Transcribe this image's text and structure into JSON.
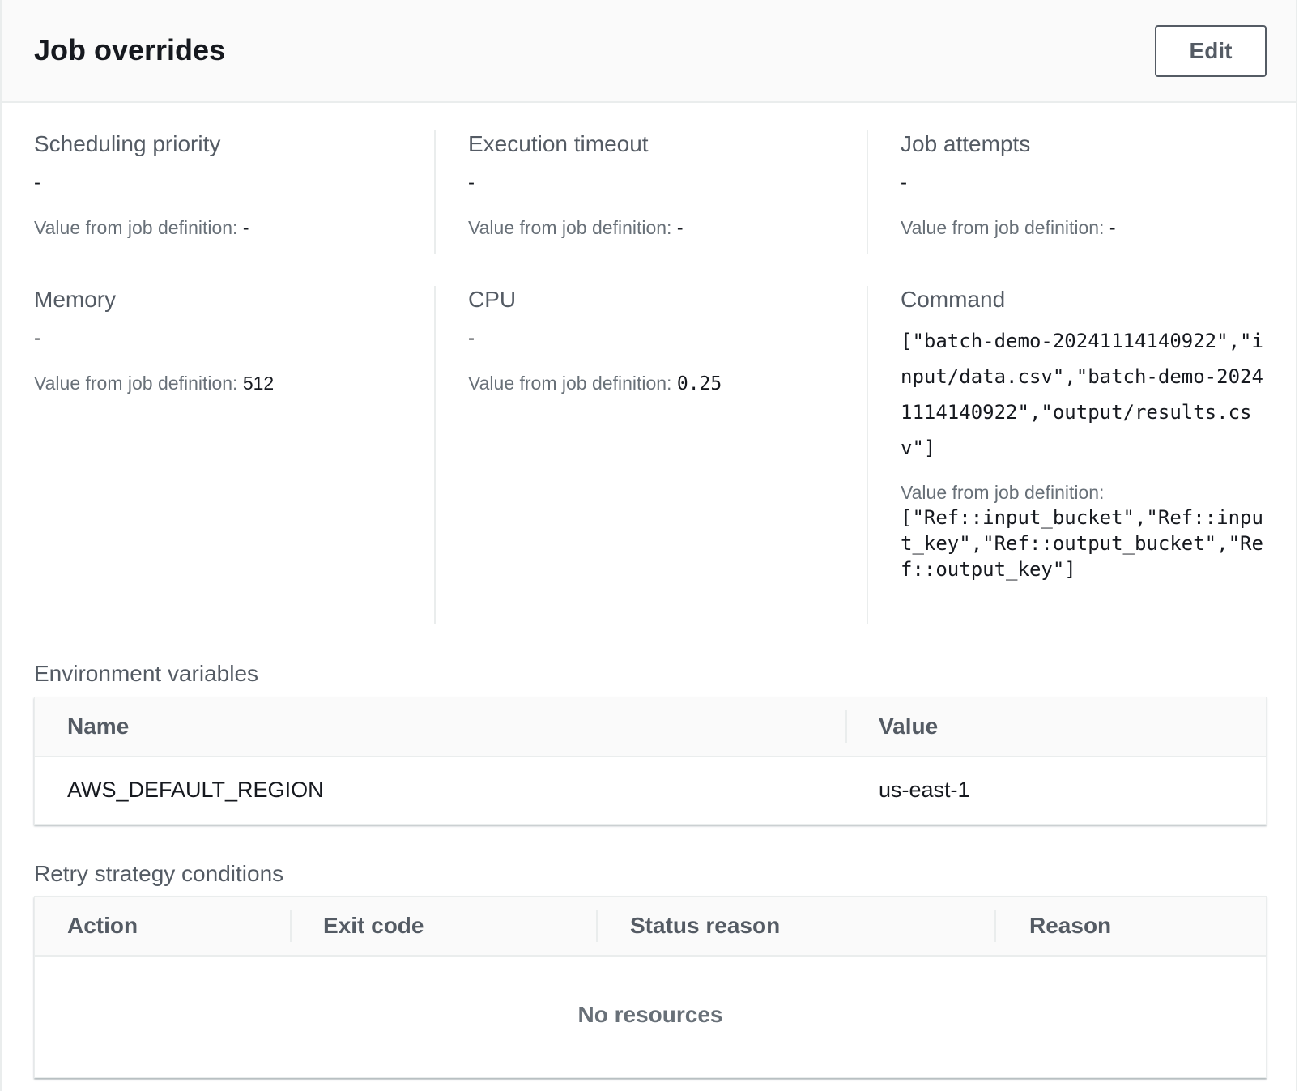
{
  "header": {
    "title": "Job overrides",
    "edit_label": "Edit"
  },
  "fields": {
    "scheduling_priority": {
      "label": "Scheduling priority",
      "value": "-",
      "def_prefix": "Value from job definition:",
      "def_value": "-"
    },
    "execution_timeout": {
      "label": "Execution timeout",
      "value": "-",
      "def_prefix": "Value from job definition:",
      "def_value": "-"
    },
    "job_attempts": {
      "label": "Job attempts",
      "value": "-",
      "def_prefix": "Value from job definition:",
      "def_value": "-"
    },
    "memory": {
      "label": "Memory",
      "value": "-",
      "def_prefix": "Value from job definition:",
      "def_value": "512"
    },
    "cpu": {
      "label": "CPU",
      "value": "-",
      "def_prefix": "Value from job definition:",
      "def_value": "0.25"
    },
    "command": {
      "label": "Command",
      "value": "[\"batch-demo-20241114140922\",\"input/data.csv\",\"batch-demo-20241114140922\",\"output/results.csv\"]",
      "def_prefix": "Value from job definition:",
      "def_value": "[\"Ref::input_bucket\",\"Ref::input_key\",\"Ref::output_bucket\",\"Ref::output_key\"]"
    }
  },
  "env_vars": {
    "label": "Environment variables",
    "columns": [
      "Name",
      "Value"
    ],
    "rows": [
      {
        "name": "AWS_DEFAULT_REGION",
        "value": "us-east-1"
      }
    ]
  },
  "retry": {
    "label": "Retry strategy conditions",
    "columns": [
      "Action",
      "Exit code",
      "Status reason",
      "Reason"
    ],
    "empty_text": "No resources"
  }
}
